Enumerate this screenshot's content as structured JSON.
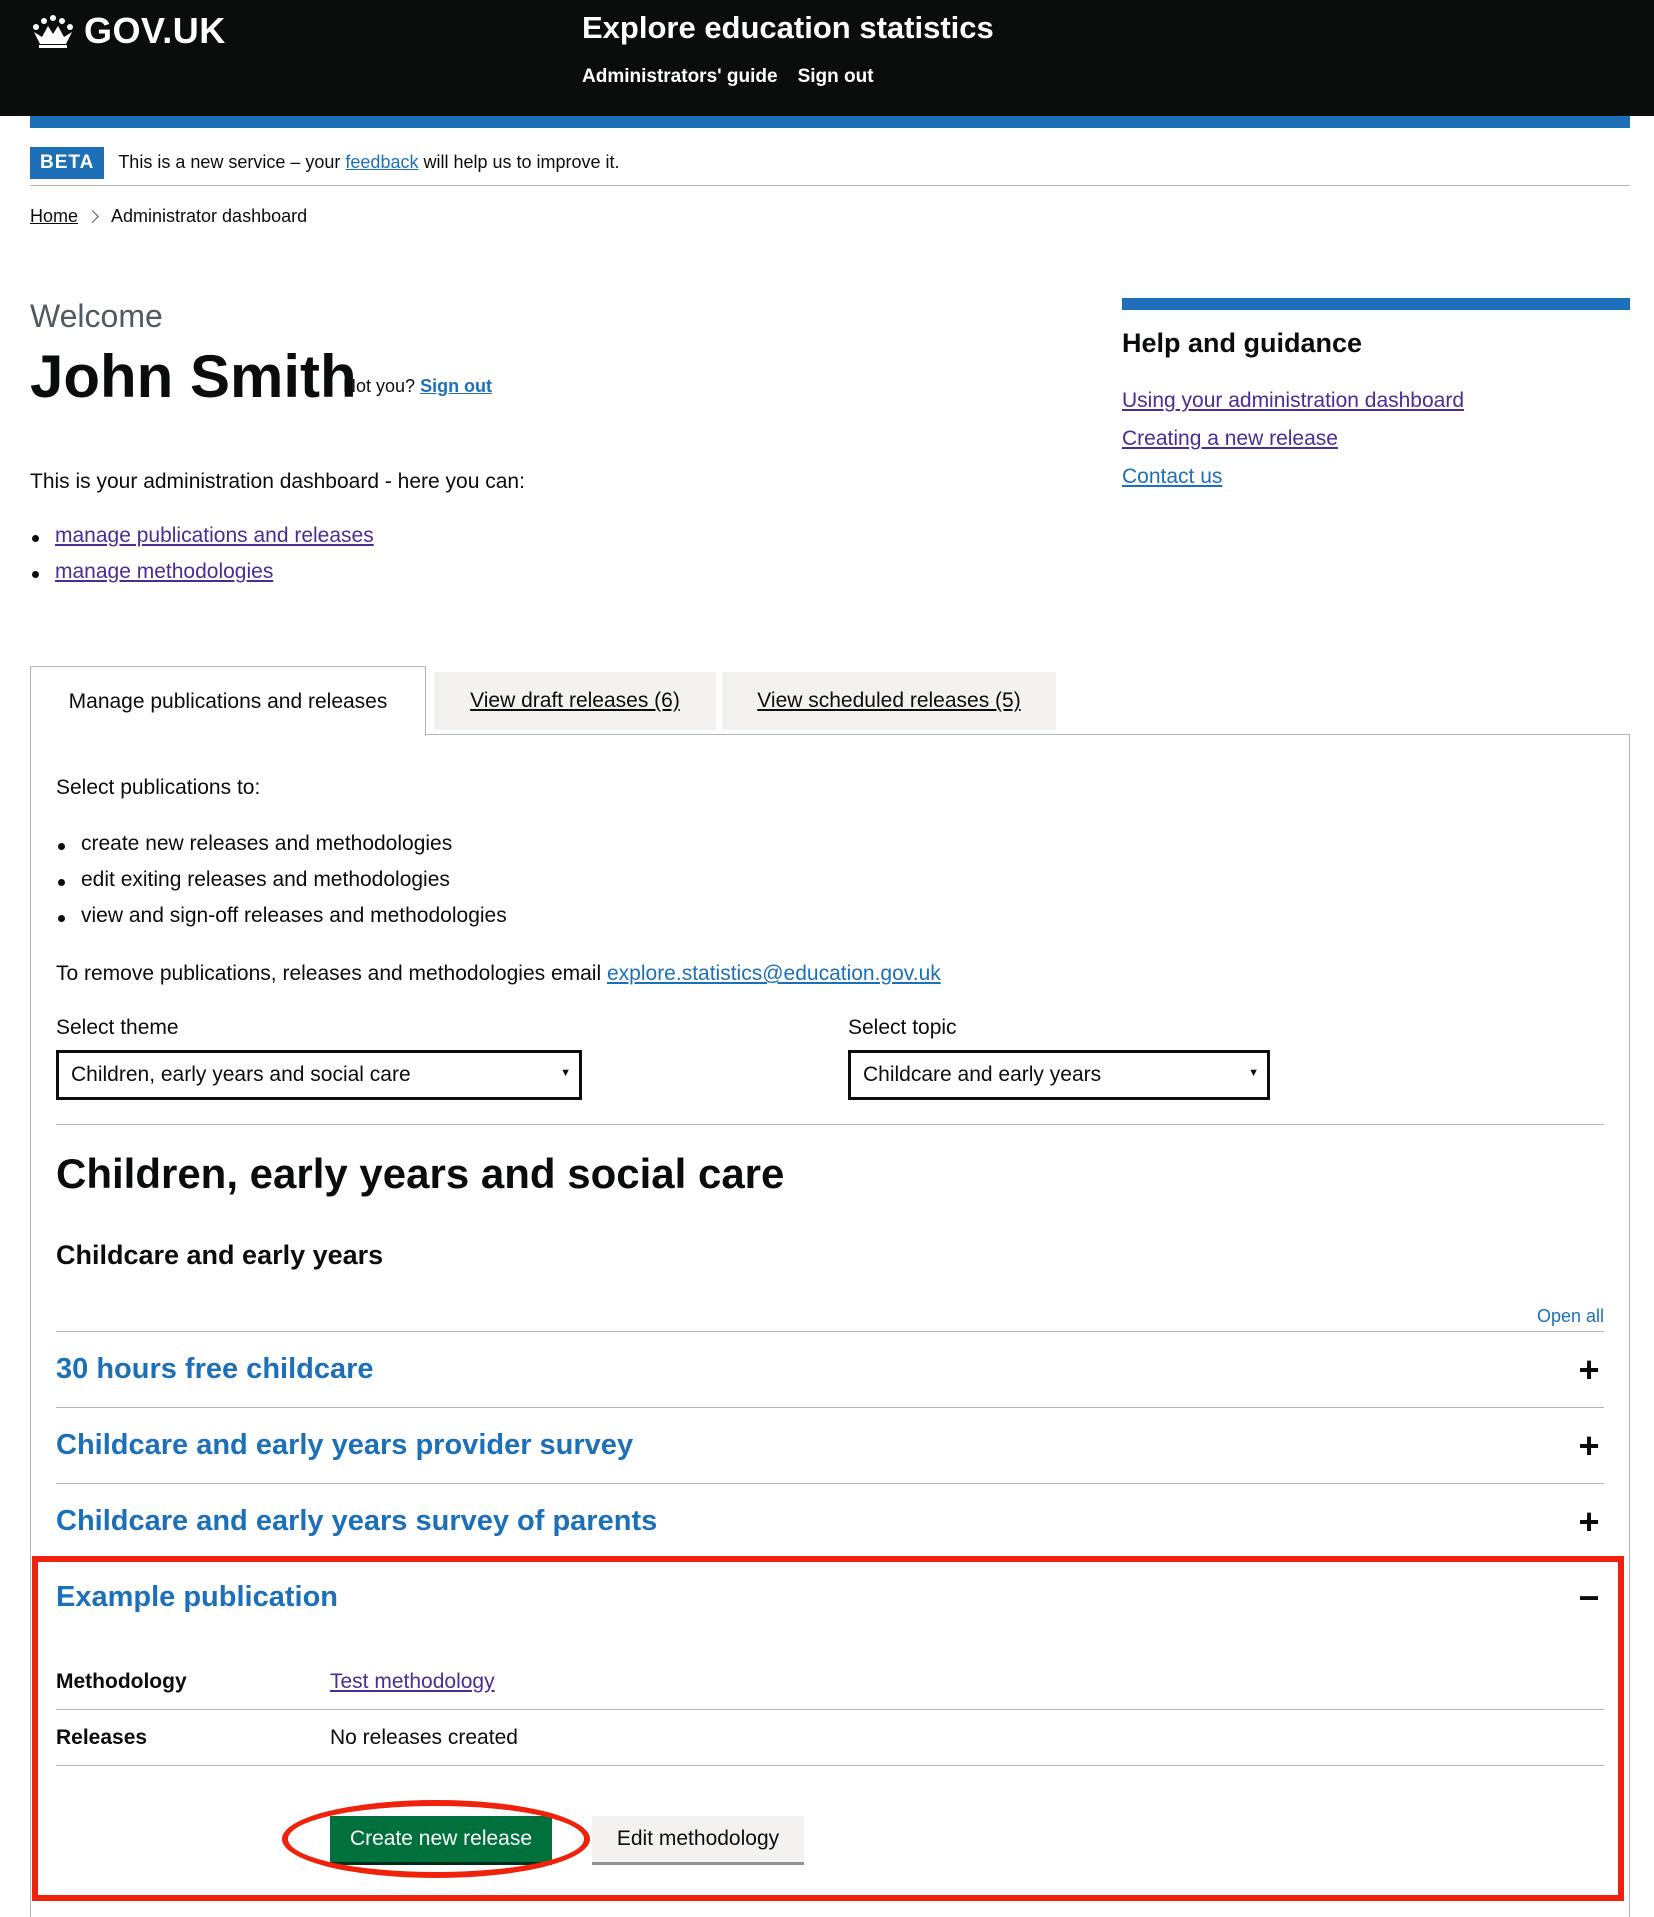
{
  "header": {
    "logo_text": "GOV.UK",
    "service_name": "Explore education statistics",
    "nav": [
      "Administrators' guide",
      "Sign out"
    ]
  },
  "beta_banner": {
    "tag": "BETA",
    "text_before": "This is a new service – your ",
    "link": "feedback",
    "text_after": " will help us to improve it."
  },
  "breadcrumb": {
    "home": "Home",
    "current": "Administrator dashboard"
  },
  "welcome": {
    "greeting": "Welcome",
    "user_name": "John Smith",
    "not_you": "Not you?",
    "sign_out": "Sign out"
  },
  "dashboard_intro": {
    "text": "This is your administration dashboard - here you can:",
    "links": [
      "manage publications and releases",
      "manage methodologies"
    ]
  },
  "help": {
    "title": "Help and guidance",
    "links": [
      "Using your administration dashboard",
      "Creating a new release",
      "Contact us"
    ]
  },
  "tabs": [
    {
      "label": "Manage publications and releases",
      "active": true
    },
    {
      "label": "View draft releases (6)",
      "active": false
    },
    {
      "label": "View scheduled releases (5)",
      "active": false
    }
  ],
  "panel": {
    "intro": "Select publications to:",
    "bullets": [
      "create new releases and methodologies",
      "edit exiting releases and methodologies",
      "view and sign-off releases and methodologies"
    ],
    "remove_text": "To remove publications, releases and methodologies email ",
    "remove_email": "explore.statistics@education.gov.uk",
    "theme_label": "Select theme",
    "theme_value": "Children, early years and social care",
    "topic_label": "Select topic",
    "topic_value": "Childcare and early years",
    "theme_heading": "Children, early years and social care",
    "topic_heading": "Childcare and early years",
    "open_all": "Open all"
  },
  "accordion": [
    {
      "title": "30 hours free childcare",
      "sign": "+"
    },
    {
      "title": "Childcare and early years provider survey",
      "sign": "+"
    },
    {
      "title": "Childcare and early years survey of parents",
      "sign": "+"
    },
    {
      "title": "Example publication",
      "sign": "−"
    }
  ],
  "publication": {
    "methodology_key": "Methodology",
    "methodology_value": "Test methodology",
    "releases_key": "Releases",
    "releases_value": "No releases created",
    "create_button": "Create new release",
    "edit_button": "Edit methodology"
  },
  "colors": {
    "header_bg": "#0b0c0c",
    "accent_blue": "#1d70b8",
    "link_purple": "#4c2c92",
    "button_green": "#00703c",
    "highlight_red": "#f0220c"
  }
}
